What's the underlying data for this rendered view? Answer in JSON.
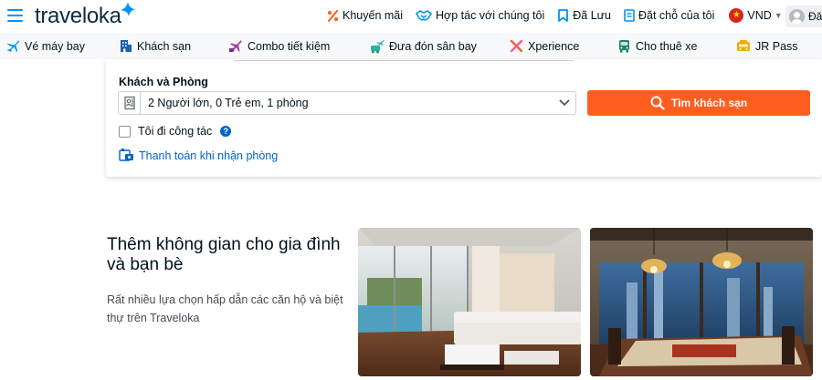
{
  "header": {
    "logo_text": "traveloka",
    "links": [
      {
        "label": "Khuyến mãi",
        "icon": "percent-icon",
        "color": "#ff5e1f"
      },
      {
        "label": "Hợp tác với chúng tôi",
        "icon": "handshake-icon",
        "color": "#0194f3"
      },
      {
        "label": "Đã Lưu",
        "icon": "bookmark-icon",
        "color": "#0194f3"
      },
      {
        "label": "Đặt chỗ của tôi",
        "icon": "booking-list-icon",
        "color": "#0194f3"
      }
    ],
    "currency": "VND",
    "user_label": "Đă"
  },
  "product_nav": [
    {
      "label": "Vé máy bay",
      "icon": "airplane-icon"
    },
    {
      "label": "Khách sạn",
      "icon": "hotel-icon"
    },
    {
      "label": "Combo tiết kiệm",
      "icon": "combo-icon"
    },
    {
      "label": "Đưa đón sân bay",
      "icon": "airport-transfer-icon"
    },
    {
      "label": "Xperience",
      "icon": "xperience-icon"
    },
    {
      "label": "Cho thuê xe",
      "icon": "car-rental-icon"
    },
    {
      "label": "JR Pass",
      "icon": "jr-pass-icon"
    }
  ],
  "search": {
    "guests_label": "Khách và Phòng",
    "guests_value": "2 Người lớn, 0 Trẻ em, 1 phòng",
    "search_button": "Tìm khách sạn",
    "business_trip": "Tôi đi công tác",
    "pay_at_hotel": "Thanh toán khi nhận phòng"
  },
  "promo": {
    "title": "Thêm không gian cho gia đình và bạn bè",
    "description": "Rất nhiều lựa chọn hấp dẫn các căn hộ và biệt thự trên Traveloka"
  },
  "colors": {
    "brand_blue": "#0194f3",
    "link_blue": "#0264c8",
    "cta_orange": "#ff5e1f",
    "text_dark": "#03121a"
  }
}
